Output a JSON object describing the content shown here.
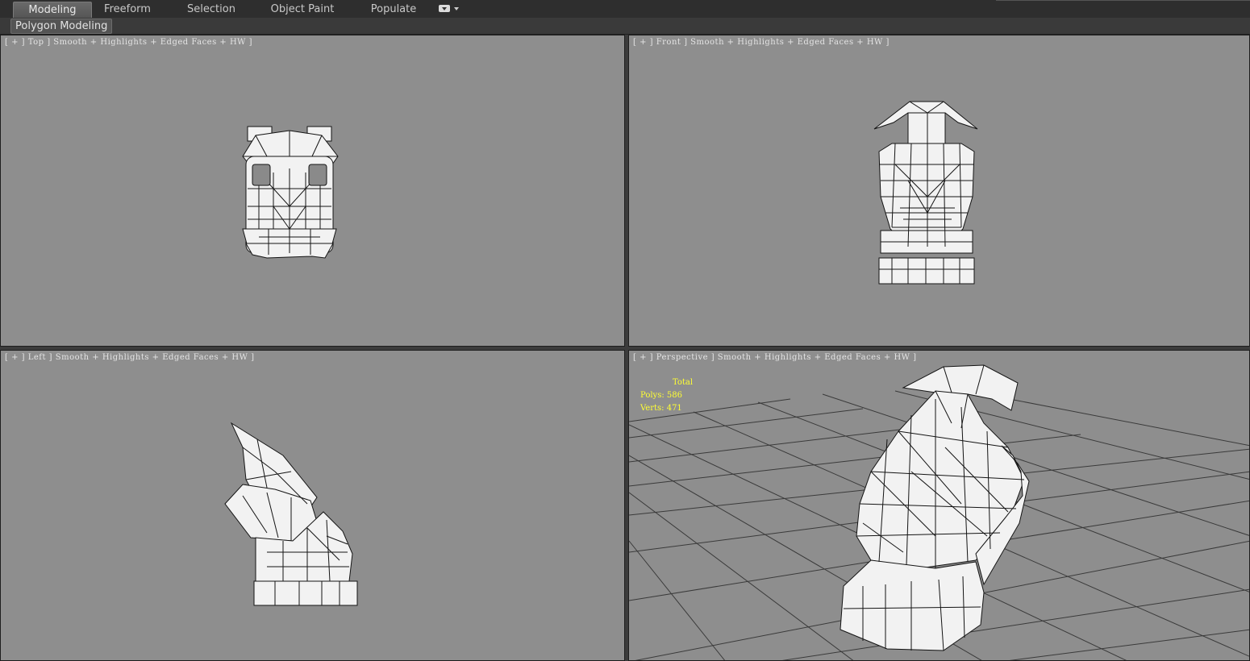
{
  "ribbon": {
    "tabs": [
      "Modeling",
      "Freeform",
      "Selection",
      "Object Paint",
      "Populate"
    ],
    "active_tab": "Modeling",
    "sub_tab": "Polygon Modeling"
  },
  "viewports": {
    "top": {
      "label": "[ + ] Top ] Smooth + Highlights + Edged Faces + HW ]"
    },
    "front": {
      "label": "[ + ] Front ] Smooth + Highlights + Edged Faces + HW ]"
    },
    "left": {
      "label": "[ + ] Left ] Smooth + Highlights + Edged Faces + HW ]"
    },
    "perspective": {
      "label": "[ + ] Perspective ] Smooth + Highlights + Edged Faces + HW ]",
      "stats": {
        "heading": "Total",
        "polys": "Polys: 586",
        "verts": "Verts: 471"
      }
    }
  },
  "colors": {
    "viewport_bg": "#8e8e8e",
    "mesh_fill": "#f2f2f2",
    "mesh_edge": "#141414",
    "stats_text": "#ffff33",
    "active_border": "#fde060"
  }
}
